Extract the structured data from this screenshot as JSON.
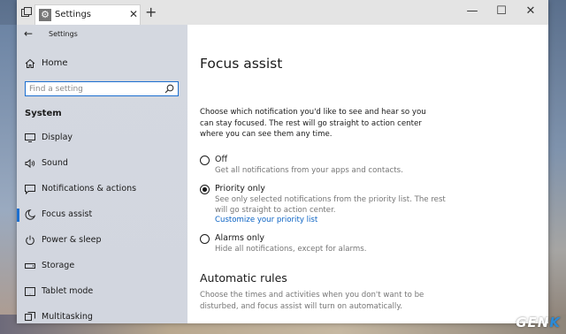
{
  "window": {
    "tab_title": "Settings",
    "close_tab_glyph": "✕",
    "new_tab_glyph": "+",
    "minimize_glyph": "—",
    "maximize_glyph": "☐",
    "close_glyph": "✕"
  },
  "sidebar": {
    "back_glyph": "←",
    "app_title": "Settings",
    "home_label": "Home",
    "search_placeholder": "Find a setting",
    "section_title": "System",
    "items": [
      {
        "label": "Display",
        "icon": "display-icon"
      },
      {
        "label": "Sound",
        "icon": "sound-icon"
      },
      {
        "label": "Notifications & actions",
        "icon": "notifications-icon"
      },
      {
        "label": "Focus assist",
        "icon": "moon-icon",
        "active": true
      },
      {
        "label": "Power & sleep",
        "icon": "power-icon"
      },
      {
        "label": "Storage",
        "icon": "storage-icon"
      },
      {
        "label": "Tablet mode",
        "icon": "tablet-mode-icon"
      },
      {
        "label": "Multitasking",
        "icon": "multitasking-icon"
      }
    ]
  },
  "main": {
    "page_title": "Focus assist",
    "intro": "Choose which notification you'd like to see and hear so you can stay focused. The rest will go straight to action center where you can see them any time.",
    "options": [
      {
        "title": "Off",
        "desc": "Get all notifications from your apps and contacts.",
        "selected": false
      },
      {
        "title": "Priority only",
        "desc": "See only selected notifications from the priority list. The rest will go straight to action center.",
        "link": "Customize your priority list",
        "selected": true
      },
      {
        "title": "Alarms only",
        "desc": "Hide all notifications, except for alarms.",
        "selected": false
      }
    ],
    "rules_heading": "Automatic rules",
    "rules_desc": "Choose the times and activities when you don't want to be disturbed, and focus assist will turn on automatically."
  },
  "watermark": {
    "text": "GEN",
    "accent": "K"
  },
  "colors": {
    "accent": "#1c6fd0",
    "link": "#0b63c4",
    "sidebar_bg": "#d3d7df"
  }
}
